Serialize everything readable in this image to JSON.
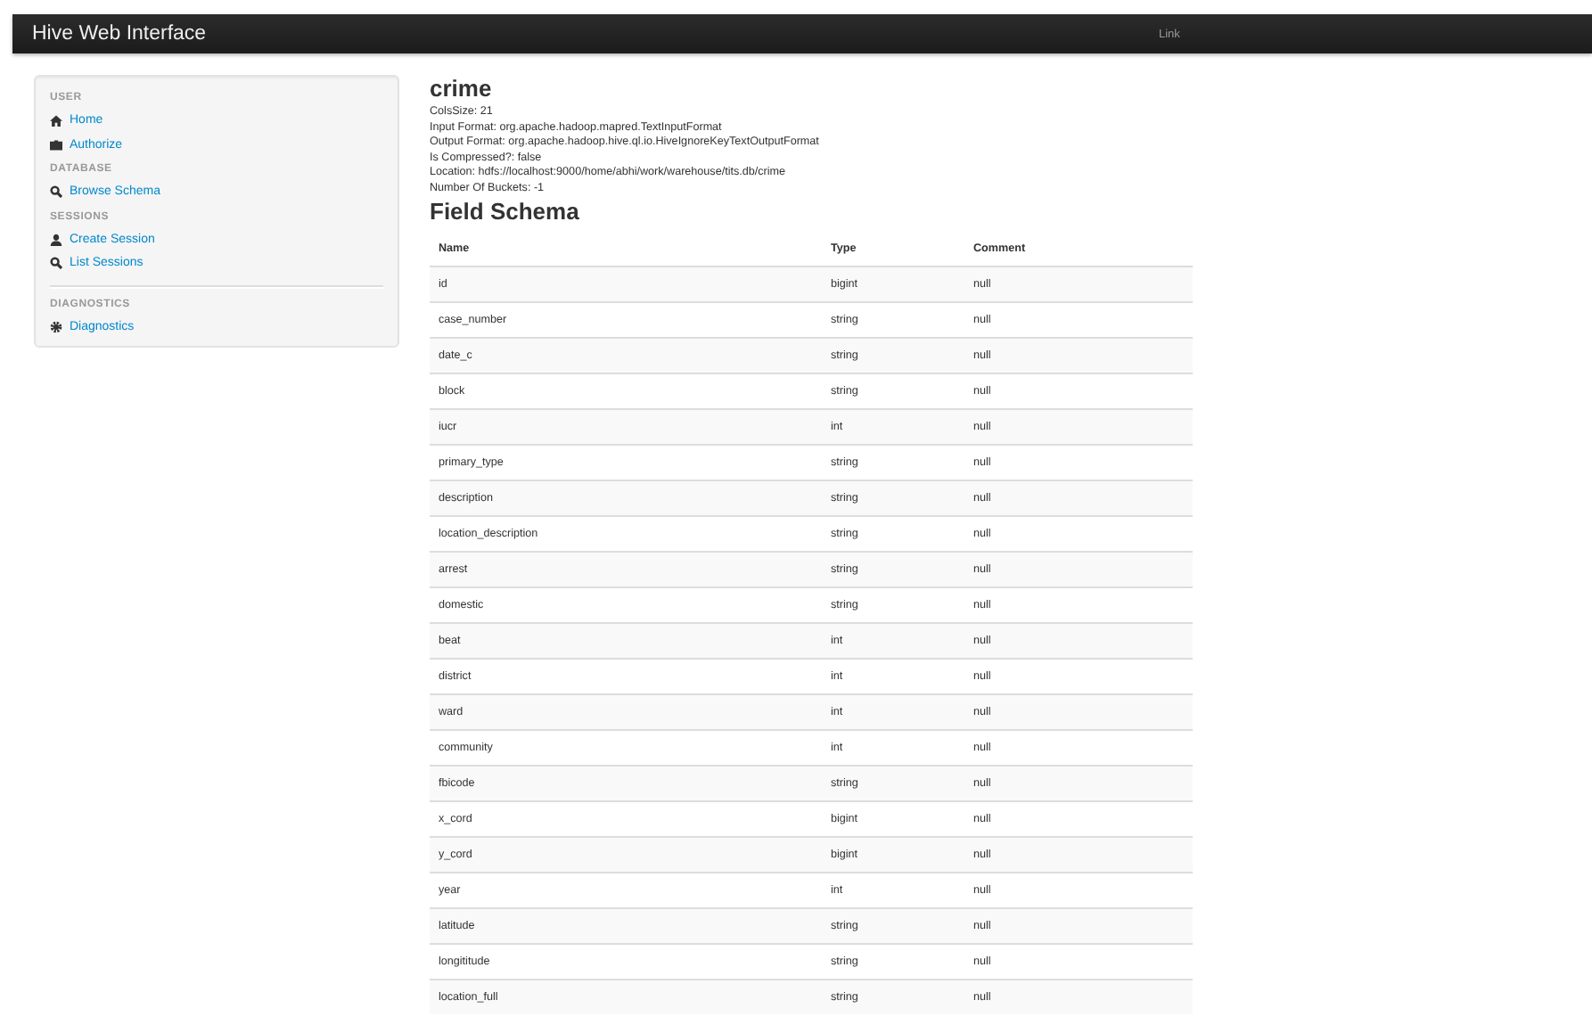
{
  "navbar": {
    "brand": "Hive Web Interface",
    "link": "Link"
  },
  "sidebar": {
    "sections": [
      {
        "header": "USER",
        "divider": false,
        "items": [
          "Home",
          "Authorize"
        ]
      },
      {
        "header": "DATABASE",
        "divider": false,
        "items": [
          "Browse Schema"
        ]
      },
      {
        "header": "SESSIONS",
        "divider": false,
        "items": [
          "Create Session",
          "List Sessions"
        ]
      },
      {
        "header": "DIAGNOSTICS",
        "divider": true,
        "items": [
          "Diagnostics"
        ]
      }
    ]
  },
  "table_info": {
    "title": "crime",
    "details": [
      "ColsSize: 21",
      "Input Format: org.apache.hadoop.mapred.TextInputFormat",
      "Output Format: org.apache.hadoop.hive.ql.io.HiveIgnoreKeyTextOutputFormat",
      "Is Compressed?: false",
      "Location: hdfs://localhost:9000/home/abhi/work/warehouse/tits.db/crime",
      "Number Of Buckets: -1"
    ]
  },
  "field_schema": {
    "title": "Field Schema",
    "columns": [
      "Name",
      "Type",
      "Comment"
    ],
    "rows": [
      [
        "id",
        "bigint",
        "null"
      ],
      [
        "case_number",
        "string",
        "null"
      ],
      [
        "date_c",
        "string",
        "null"
      ],
      [
        "block",
        "string",
        "null"
      ],
      [
        "iucr",
        "int",
        "null"
      ],
      [
        "primary_type",
        "string",
        "null"
      ],
      [
        "description",
        "string",
        "null"
      ],
      [
        "location_description",
        "string",
        "null"
      ],
      [
        "arrest",
        "string",
        "null"
      ],
      [
        "domestic",
        "string",
        "null"
      ],
      [
        "beat",
        "int",
        "null"
      ],
      [
        "district",
        "int",
        "null"
      ],
      [
        "ward",
        "int",
        "null"
      ],
      [
        "community",
        "int",
        "null"
      ],
      [
        "fbicode",
        "string",
        "null"
      ],
      [
        "x_cord",
        "bigint",
        "null"
      ],
      [
        "y_cord",
        "bigint",
        "null"
      ],
      [
        "year",
        "int",
        "null"
      ],
      [
        "latitude",
        "string",
        "null"
      ],
      [
        "longititude",
        "string",
        "null"
      ],
      [
        "location_full",
        "string",
        "null"
      ]
    ]
  }
}
